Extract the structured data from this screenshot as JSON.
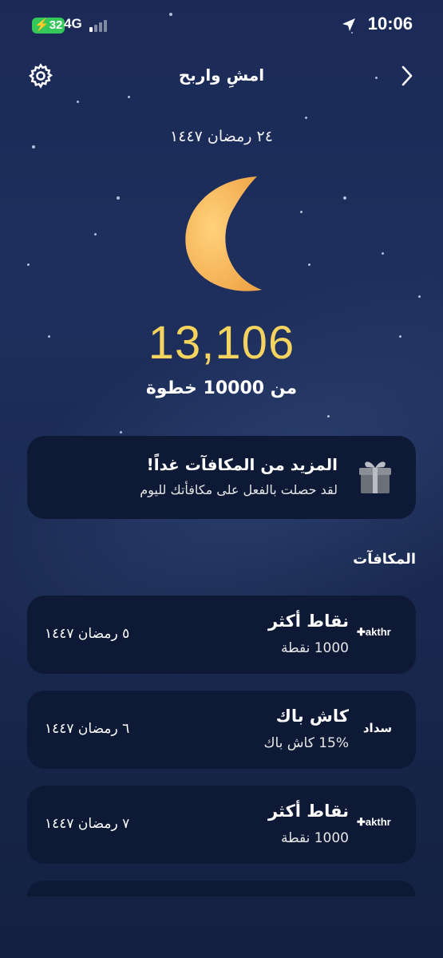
{
  "status_bar": {
    "battery": "32",
    "network": "4G",
    "time": "10:06"
  },
  "header": {
    "title": "امشِ واربح"
  },
  "hijri_date": "٢٤ رمضان ١٤٤٧",
  "steps": {
    "count": "13,106",
    "goal_text": "من 10000 خطوة"
  },
  "info_card": {
    "title": "المزيد من المكافآت غداً!",
    "subtitle": "لقد حصلت بالفعل على مكافأتك لليوم",
    "icon": "gift-icon"
  },
  "rewards": {
    "section_title": "المكافآت",
    "items": [
      {
        "title": "نقاط أكثر",
        "subtitle": "1000 نقطة",
        "date": "٥ رمضان ١٤٤٧",
        "logo_text": "akthr"
      },
      {
        "title": "كاش باك",
        "subtitle": "15% كاش باك",
        "date": "٦ رمضان ١٤٤٧",
        "logo_text": "سداد"
      },
      {
        "title": "نقاط أكثر",
        "subtitle": "1000 نقطة",
        "date": "٧ رمضان ١٤٤٧",
        "logo_text": "akthr"
      }
    ]
  },
  "colors": {
    "steps": "#f4d35e",
    "card_bg": "#0e1a35",
    "moon": "#f5b955",
    "battery": "#34c759"
  }
}
